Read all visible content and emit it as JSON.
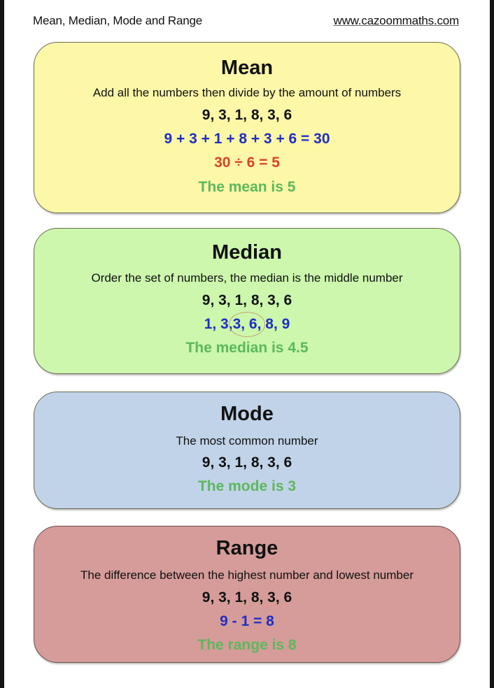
{
  "header": {
    "title": "Mean, Median, Mode and Range",
    "website": "www.cazoommaths.com"
  },
  "colors": {
    "mean_bg": "#fdf7a8",
    "median_bg": "#ccf7ad",
    "mode_bg": "#c1d3e8",
    "range_bg": "#d59c99",
    "blue_text": "#1f2fc4",
    "red_text": "#d9432a",
    "green_text": "#5cb85c"
  },
  "mean": {
    "title": "Mean",
    "description": "Add all the numbers then divide by the amount of numbers",
    "numbers": "9, 3, 1, 8, 3, 6",
    "sum": "9 + 3 + 1 + 8 + 3 + 6 = 30",
    "division": "30 ÷ 6 = 5",
    "result": "The mean is 5"
  },
  "median": {
    "title": "Median",
    "description": "Order the set of numbers, the median is the middle number",
    "numbers": "9, 3, 1, 8, 3, 6",
    "ordered_before": "1, 3,",
    "ordered_middle": "3, 6,",
    "ordered_after": "8, 9",
    "result": "The median is 4.5"
  },
  "mode": {
    "title": "Mode",
    "description": "The most common number",
    "numbers": "9, 3, 1, 8, 3, 6",
    "result": "The mode is 3"
  },
  "range": {
    "title": "Range",
    "description": "The difference between the highest number and lowest number",
    "numbers": "9, 3, 1, 8, 3, 6",
    "calculation": "9 - 1 = 8",
    "result": "The range is 8"
  }
}
